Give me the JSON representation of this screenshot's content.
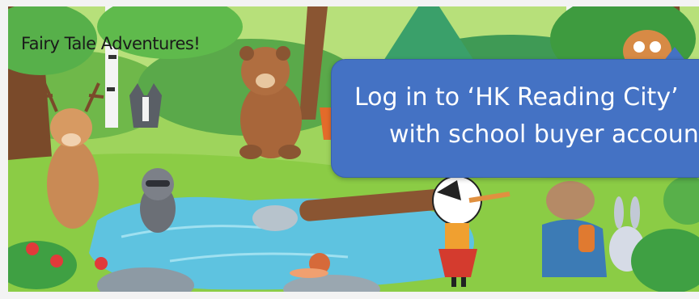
{
  "slide": {
    "title": "Fairy Tale Adventures!",
    "callout_line1": "Log in to ‘HK Reading City’",
    "callout_line2": "with school buyer account"
  },
  "colors": {
    "callout_bg": "#4472c4",
    "callout_text": "#ffffff",
    "grass": "#8cc850",
    "water": "#5ec3e0"
  },
  "icons": [
    "deer-icon",
    "bear-icon",
    "wolf-icon",
    "raccoon-icon",
    "owl-icon",
    "rabbit-icon",
    "bunny-icon",
    "fox-icon",
    "snail-icon",
    "girl-character-icon"
  ]
}
